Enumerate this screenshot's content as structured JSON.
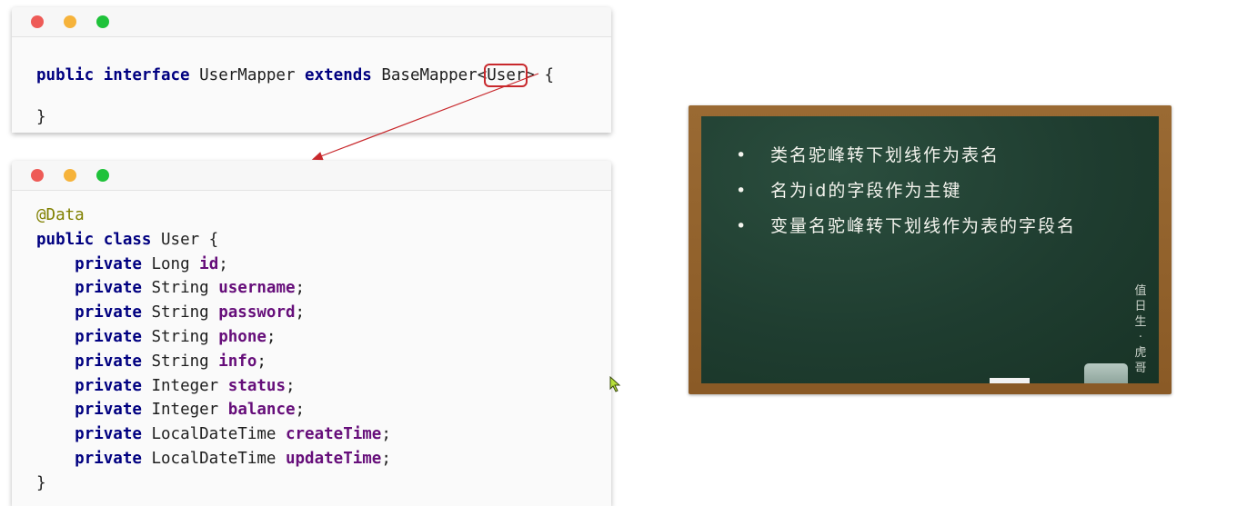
{
  "window1": {
    "code": {
      "line1_kw1": "public",
      "line1_kw2": "interface",
      "line1_name": "UserMapper",
      "line1_kw3": "extends",
      "line1_base": "BaseMapper<",
      "line1_generic": "User",
      "line1_end": "> {",
      "line2": "}"
    }
  },
  "window2": {
    "annotation": "@Data",
    "class_kw1": "public",
    "class_kw2": "class",
    "class_name": "User {",
    "fields": [
      {
        "modifier": "private",
        "type": "Long",
        "name": "id"
      },
      {
        "modifier": "private",
        "type": "String",
        "name": "username"
      },
      {
        "modifier": "private",
        "type": "String",
        "name": "password"
      },
      {
        "modifier": "private",
        "type": "String",
        "name": "phone"
      },
      {
        "modifier": "private",
        "type": "String",
        "name": "info"
      },
      {
        "modifier": "private",
        "type": "Integer",
        "name": "status"
      },
      {
        "modifier": "private",
        "type": "Integer",
        "name": "balance"
      },
      {
        "modifier": "private",
        "type": "LocalDateTime",
        "name": "createTime"
      },
      {
        "modifier": "private",
        "type": "LocalDateTime",
        "name": "updateTime"
      }
    ],
    "closing": "}"
  },
  "blackboard": {
    "items": [
      "类名驼峰转下划线作为表名",
      "名为id的字段作为主键",
      "变量名驼峰转下划线作为表的字段名"
    ],
    "duty_label": [
      "值",
      "日",
      "生",
      "·",
      "虎",
      "哥"
    ]
  },
  "colors": {
    "keyword": "#000080",
    "field": "#660e7a",
    "annotation": "#808000",
    "highlight": "#c8282c",
    "board": "#1f3d30",
    "frame": "#8a5a26"
  },
  "icons": [
    "close-dot-icon",
    "minimize-dot-icon",
    "zoom-dot-icon",
    "mouse-cursor-icon",
    "arrow-connector"
  ]
}
